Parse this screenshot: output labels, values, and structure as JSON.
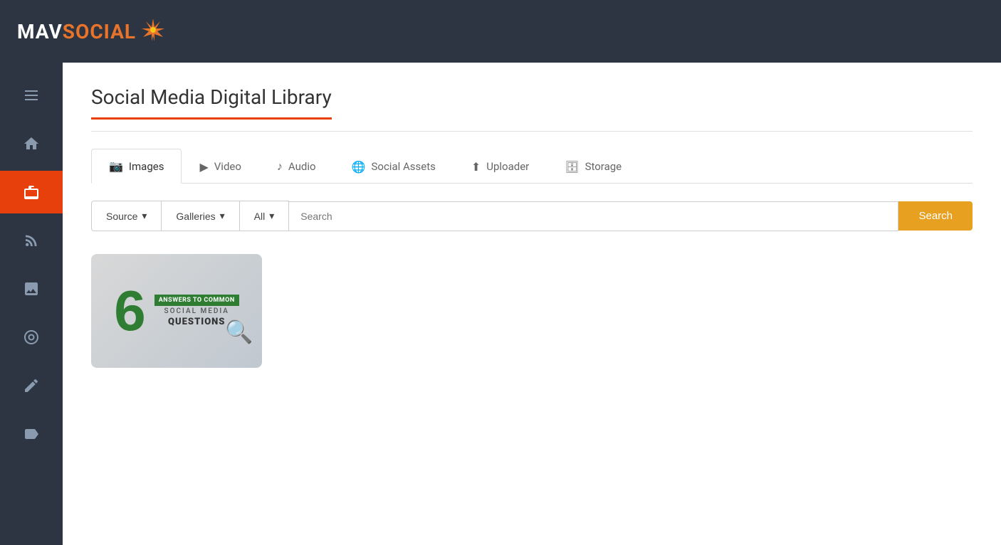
{
  "header": {
    "logo_mav": "MAV",
    "logo_social": "SOCIAL",
    "logo_icon": "✳"
  },
  "sidebar": {
    "items": [
      {
        "id": "menu",
        "icon": "menu",
        "active": false
      },
      {
        "id": "home",
        "icon": "home",
        "active": false
      },
      {
        "id": "briefcase",
        "icon": "briefcase",
        "active": true
      },
      {
        "id": "feed",
        "icon": "rss",
        "active": false
      },
      {
        "id": "image",
        "icon": "image",
        "active": false
      },
      {
        "id": "target",
        "icon": "target",
        "active": false
      },
      {
        "id": "edit",
        "icon": "edit",
        "active": false
      },
      {
        "id": "tag",
        "icon": "tag",
        "active": false
      }
    ]
  },
  "page": {
    "title": "Social Media Digital Library"
  },
  "tabs": [
    {
      "id": "images",
      "label": "Images",
      "icon": "📷",
      "active": true
    },
    {
      "id": "video",
      "label": "Video",
      "icon": "▶",
      "active": false
    },
    {
      "id": "audio",
      "label": "Audio",
      "icon": "♪",
      "active": false
    },
    {
      "id": "social-assets",
      "label": "Social Assets",
      "icon": "🌐",
      "active": false
    },
    {
      "id": "uploader",
      "label": "Uploader",
      "icon": "⬆",
      "active": false
    },
    {
      "id": "storage",
      "label": "Storage",
      "icon": "🗄",
      "active": false
    }
  ],
  "filters": {
    "source_label": "Source",
    "galleries_label": "Galleries",
    "all_label": "All",
    "search_placeholder": "Search",
    "search_button": "Search"
  },
  "images": [
    {
      "id": "smq",
      "alt": "6 Answers to Common Social Media Questions",
      "number": "6",
      "line1": "ANSWERS TO COMMON",
      "line2": "SOCIAL MEDIA",
      "line3": "QUESTIONS"
    }
  ]
}
